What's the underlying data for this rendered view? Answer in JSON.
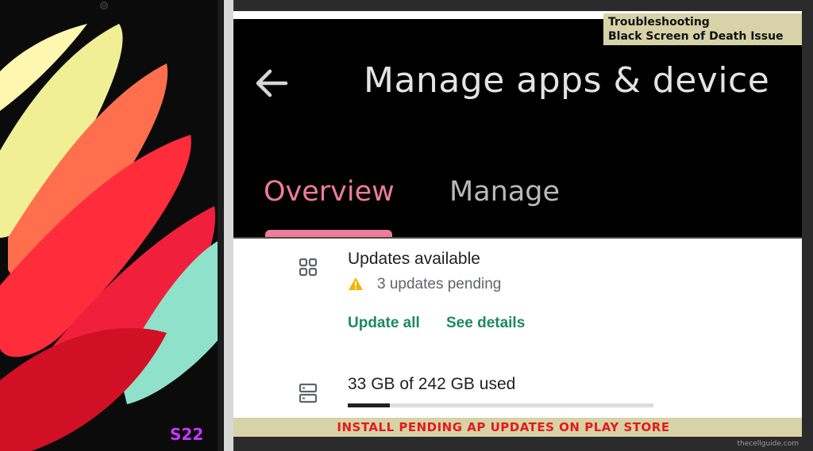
{
  "phone": {
    "model_label": "S22"
  },
  "header": {
    "title": "Manage apps & device",
    "back_icon": "arrow-left-icon"
  },
  "tabs": [
    {
      "label": "Overview",
      "selected": true,
      "color": "#f07b9d"
    },
    {
      "label": "Manage",
      "selected": false,
      "color": "#b9b9b9"
    }
  ],
  "updates": {
    "icon": "apps-grid-icon",
    "title": "Updates available",
    "warning_icon": "warning-triangle-icon",
    "pending_text": "3 updates pending",
    "update_all_label": "Update all",
    "see_details_label": "See details",
    "accent": "#1a8a5f"
  },
  "storage": {
    "icon": "storage-icon",
    "text": "33 GB of 242 GB used",
    "used_gb": 33,
    "total_gb": 242
  },
  "overlay": {
    "tag_line1": "Troubleshooting",
    "tag_line2": "Black Screen of Death Issue",
    "caption": "INSTALL PENDING AP UPDATES ON PLAY STORE",
    "watermark": "thecellguide.com"
  }
}
